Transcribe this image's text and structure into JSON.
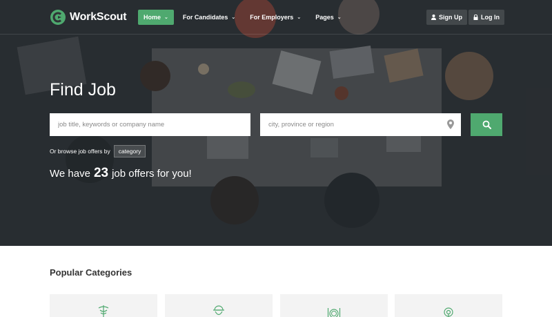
{
  "brand": {
    "name": "WorkScout",
    "accent": "#4fa96f"
  },
  "nav": {
    "items": [
      {
        "label": "Home",
        "chevron": "⌄",
        "active": true
      },
      {
        "label": "For Candidates",
        "chevron": "⌄"
      },
      {
        "label": "For Employers",
        "chevron": "⌄"
      },
      {
        "label": "Pages",
        "chevron": "⌄"
      }
    ],
    "signup_label": "Sign Up",
    "login_label": "Log In"
  },
  "hero": {
    "title": "Find Job",
    "keyword_placeholder": "job title, keywords or company name",
    "location_placeholder": "city, province or region",
    "browse_text": "Or browse job offers by",
    "category_label": "category",
    "offers_prefix": "We have",
    "offers_count": "23",
    "offers_suffix": "job offers for you!"
  },
  "categories": {
    "title": "Popular Categories",
    "cards": [
      {
        "icon": "medical-caduceus-icon"
      },
      {
        "icon": "worker-helmet-icon"
      },
      {
        "icon": "restaurant-plate-icon"
      },
      {
        "icon": "broadcast-tower-icon"
      }
    ]
  }
}
